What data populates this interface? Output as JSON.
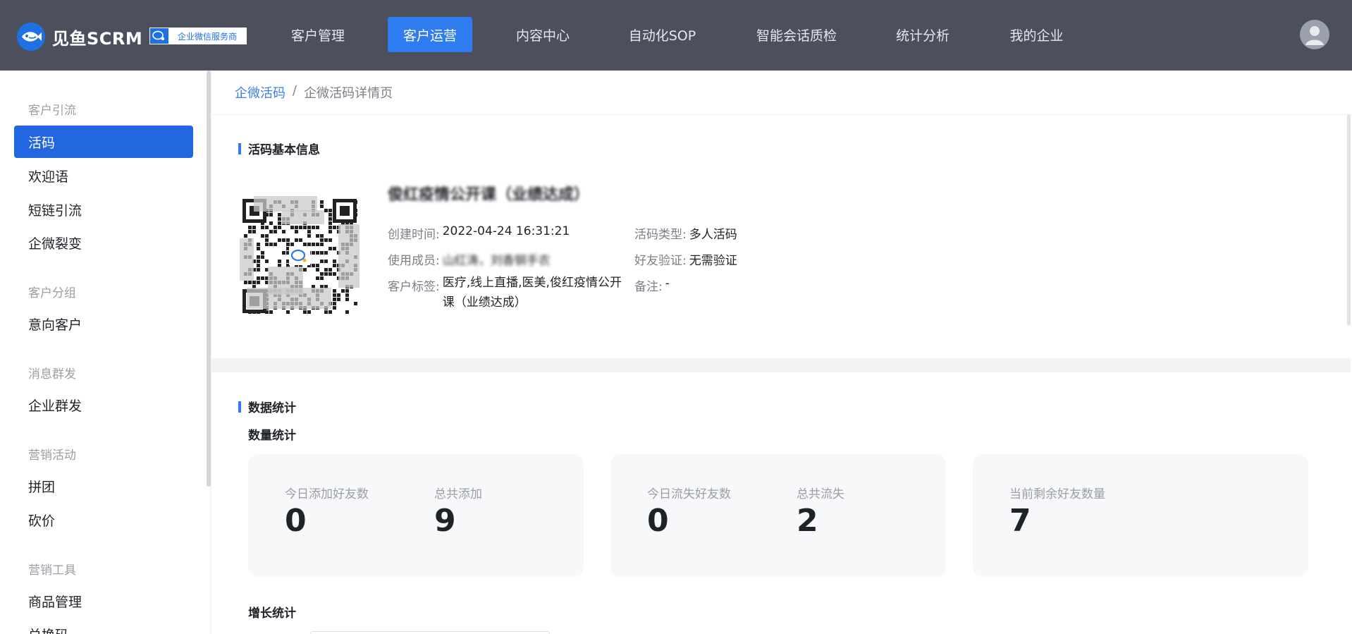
{
  "header": {
    "logo_text": "见鱼SCRM",
    "badge_text": "企业微信服务商",
    "nav": [
      {
        "label": "客户管理",
        "active": false
      },
      {
        "label": "客户运营",
        "active": true
      },
      {
        "label": "内容中心",
        "active": false
      },
      {
        "label": "自动化SOP",
        "active": false
      },
      {
        "label": "智能会话质检",
        "active": false
      },
      {
        "label": "统计分析",
        "active": false
      },
      {
        "label": "我的企业",
        "active": false
      }
    ]
  },
  "sidebar": {
    "groups": [
      {
        "title": "客户引流",
        "items": [
          "活码",
          "欢迎语",
          "短链引流",
          "企微裂变"
        ]
      },
      {
        "title": "客户分组",
        "items": [
          "意向客户"
        ]
      },
      {
        "title": "消息群发",
        "items": [
          "企业群发"
        ]
      },
      {
        "title": "营销活动",
        "items": [
          "拼团",
          "砍价"
        ]
      },
      {
        "title": "营销工具",
        "items": [
          "商品管理",
          "兑换码"
        ]
      }
    ],
    "active_item": "活码"
  },
  "breadcrumb": {
    "parent": "企微活码",
    "separator": "/",
    "current": "企微活码详情页"
  },
  "basic_info": {
    "section_title": "活码基本信息",
    "code_name": "俊红疫情公开课（业绩达成）",
    "created_label": "创建时间:",
    "created_value": "2022-04-24 16:31:21",
    "members_label": "使用成员:",
    "members_value": "山红涛，刘香钢手农",
    "tags_label": "客户标签:",
    "tags_value": "医疗,线上直播,医美,俊红疫情公开课（业绩达成）",
    "type_label": "活码类型:",
    "type_value": "多人活码",
    "verify_label": "好友验证:",
    "verify_value": "无需验证",
    "note_label": "备注:",
    "note_value": "-"
  },
  "stats": {
    "section_title": "数据统计",
    "count_title": "数量统计",
    "cards": [
      {
        "items": [
          {
            "label": "今日添加好友数",
            "value": "0"
          },
          {
            "label": "总共添加",
            "value": "9"
          }
        ]
      },
      {
        "items": [
          {
            "label": "今日流失好友数",
            "value": "0"
          },
          {
            "label": "总共流失",
            "value": "2"
          }
        ]
      },
      {
        "items": [
          {
            "label": "当前剩余好友数量",
            "value": "7"
          }
        ]
      }
    ],
    "growth_title": "增长统计"
  },
  "colors": {
    "topbar": "#4b505c",
    "accent": "#2f7bf0",
    "sidebar_active": "#2266e0",
    "link": "#3b7fe4"
  }
}
